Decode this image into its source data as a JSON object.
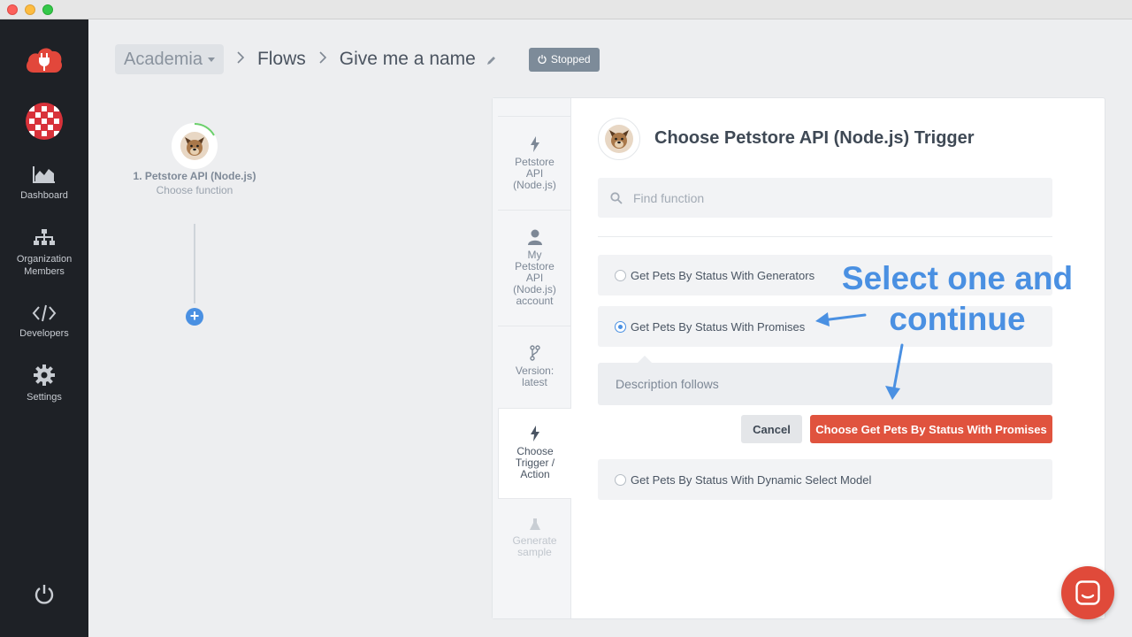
{
  "window": {
    "controls": [
      "close",
      "minimize",
      "zoom"
    ]
  },
  "sidebar": {
    "logo_icon": "cloud-plug-icon",
    "items": [
      {
        "label": "Dashboard",
        "icon": "area-chart-icon"
      },
      {
        "label_line1": "Organization",
        "label_line2": "Members",
        "icon": "org-tree-icon"
      },
      {
        "label": "Developers",
        "icon": "code-icon"
      },
      {
        "label": "Settings",
        "icon": "gear-icon"
      }
    ],
    "bottom_icon": "power-icon"
  },
  "breadcrumb": {
    "org": "Academia",
    "flows": "Flows",
    "flow_name": "Give me a name",
    "status": "Stopped"
  },
  "flow": {
    "step_title": "1. Petstore API (Node.js)",
    "step_subtitle": "Choose function"
  },
  "tabs": {
    "t1_line1": "Petstore",
    "t1_line2": "API",
    "t1_line3": "(Node.js)",
    "t2_line1": "My",
    "t2_line2": "Petstore",
    "t2_line3": "API",
    "t2_line4": "(Node.js)",
    "t2_line5": "account",
    "t3_line1": "Version:",
    "t3_line2": "latest",
    "t4_line1": "Choose",
    "t4_line2": "Trigger /",
    "t4_line3": "Action",
    "t5_line1": "Generate",
    "t5_line2": "sample"
  },
  "panel": {
    "title": "Choose Petstore API (Node.js) Trigger",
    "search_placeholder": "Find function",
    "options": [
      {
        "label": "Get Pets By Status With Generators",
        "selected": false
      },
      {
        "label": "Get Pets By Status With Promises",
        "selected": true
      },
      {
        "label": "Get Pets By Status With Dynamic Select Model",
        "selected": false
      }
    ],
    "description": "Description follows",
    "cancel_label": "Cancel",
    "choose_label": "Choose Get Pets By Status With Promises"
  },
  "annotation": {
    "line1": "Select one and",
    "line2": "continue"
  },
  "colors": {
    "sidebar_bg": "#1e2126",
    "accent_blue": "#4a90e2",
    "primary_red": "#e0533e",
    "status_badge": "#7d8b99"
  },
  "chat_icon": "chat-bubble-icon"
}
